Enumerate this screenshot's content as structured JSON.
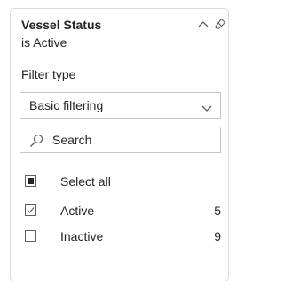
{
  "slicer": {
    "title": "Vessel Status",
    "subtitle": "is Active",
    "filter_type_label": "Filter type",
    "filter_type_value": "Basic filtering",
    "search_placeholder": "Search",
    "items": [
      {
        "label": "Select all",
        "count": "",
        "state": "partial"
      },
      {
        "label": "Active",
        "count": "5",
        "state": "checked"
      },
      {
        "label": "Inactive",
        "count": "9",
        "state": "unchecked"
      }
    ]
  },
  "icons": {
    "collapse": "chevron-up-icon",
    "clear": "eraser-icon",
    "dropdown": "chevron-down-icon",
    "search": "search-icon"
  },
  "colors": {
    "text": "#252423",
    "border": "#c8c6c4",
    "card_border": "#dcdcdc"
  }
}
